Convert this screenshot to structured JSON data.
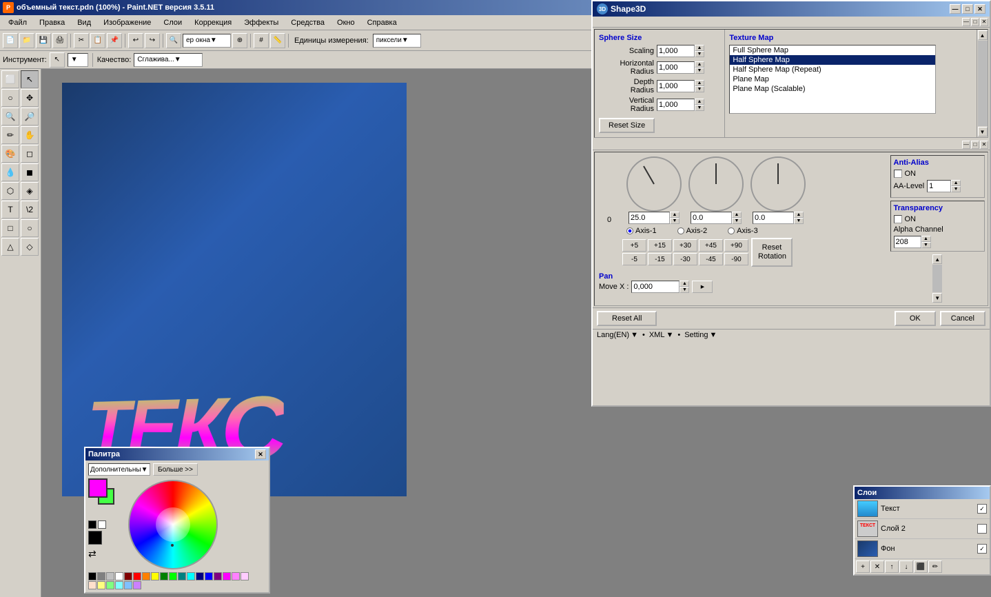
{
  "titleBar": {
    "icon": "●",
    "title": "объемный текст.pdn (100%) - Paint.NET версия 3.5.11",
    "controls": [
      "—",
      "□",
      "✕"
    ]
  },
  "menuBar": {
    "items": [
      "Файл",
      "Правка",
      "Вид",
      "Изображение",
      "Слои",
      "Коррекция",
      "Эффекты",
      "Средства",
      "Окно",
      "Справка"
    ]
  },
  "toolbar": {
    "units_label": "Единицы измерения:",
    "units_value": "пиксели"
  },
  "toolbar2": {
    "tool_label": "Инструмент:",
    "quality_label": "Качество:",
    "quality_value": "Сглажива..."
  },
  "shape3d": {
    "title": "Shape3D",
    "sphereSize": {
      "header": "Sphere Size",
      "scaling_label": "Scaling",
      "scaling_value": "1,000",
      "horizontal_label": "Horizontal",
      "horizontal_sub": "Radius",
      "horizontal_value": "1,000",
      "depth_label": "Depth",
      "depth_sub": "Radius",
      "depth_value": "1,000",
      "vertical_label": "Vertical",
      "vertical_sub": "Radius",
      "vertical_value": "1,000",
      "reset_btn": "Reset Size"
    },
    "textureMap": {
      "header": "Texture Map",
      "items": [
        "Full Sphere Map",
        "Half Sphere Map",
        "Half Sphere Map (Repeat)",
        "Plane Map",
        "Plane Map (Scalable)"
      ],
      "selected": "Half Sphere Map"
    },
    "rotation": {
      "axis1_label": "Axis-1",
      "axis2_label": "Axis-2",
      "axis3_label": "Axis-3",
      "dial1_value": "25.0",
      "dial2_value": "0.0",
      "dial3_value": "0.0",
      "steps_pos": [
        "+5",
        "+15",
        "+30",
        "+45",
        "+90"
      ],
      "steps_neg": [
        "-5",
        "-15",
        "-30",
        "-45",
        "-90"
      ],
      "reset_rotation": "Reset Rotation"
    },
    "antiAlias": {
      "header": "Anti-Alias",
      "on_label": "ON",
      "aa_level_label": "AA-Level",
      "aa_level_value": "1"
    },
    "transparency": {
      "header": "Transparency",
      "on_label": "ON",
      "alpha_label": "Alpha Channel",
      "alpha_value": "208"
    },
    "pan": {
      "header": "Pan",
      "move_x_label": "Move X :",
      "move_x_value": "0,000"
    },
    "bottom": {
      "reset_all": "Reset All",
      "ok": "OK",
      "cancel": "Cancel"
    },
    "langBar": {
      "lang": "Lang(EN)",
      "xml": "XML",
      "setting": "Setting"
    }
  },
  "palette": {
    "title": "Палитра",
    "dropdown1": "Дополнительны",
    "btn1": "Больше >>",
    "colors": [
      "#000000",
      "#808080",
      "#c0c0c0",
      "#ffffff",
      "#800000",
      "#ff0000",
      "#ff8000",
      "#ffff00",
      "#008000",
      "#00ff00",
      "#008080",
      "#00ffff",
      "#000080",
      "#0000ff",
      "#800080",
      "#ff00ff",
      "#ff80ff",
      "#ffccff",
      "#ffe0cc",
      "#ffff80",
      "#80ff80",
      "#80ffff",
      "#80c0ff",
      "#cc80ff"
    ]
  },
  "layers": {
    "items": [
      {
        "name": "Текст",
        "checked": true,
        "bg": "#22aaff"
      },
      {
        "name": "Слой 2",
        "checked": false,
        "bg": "#cccccc"
      },
      {
        "name": "Фон",
        "checked": true,
        "bg": "#1a4a8a"
      }
    ],
    "toolbar_buttons": [
      "+",
      "✕",
      "⬆",
      "⬇",
      "⬛",
      "✏"
    ]
  },
  "canvasText": "ТЕКС"
}
